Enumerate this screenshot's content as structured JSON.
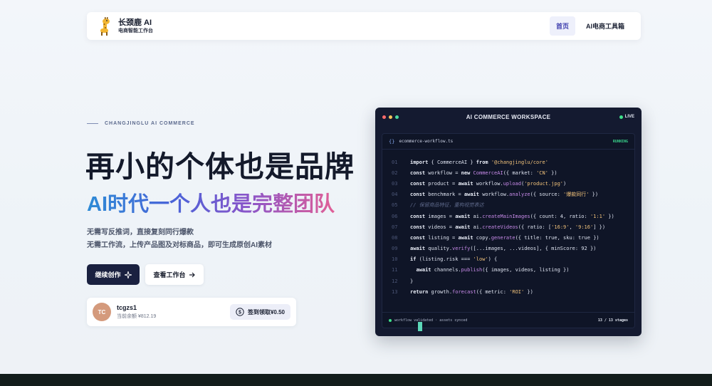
{
  "brand": {
    "name": "长颈鹿 AI",
    "subtitle": "电商智能工作台"
  },
  "nav": {
    "items": [
      {
        "label": "首页",
        "active": true
      },
      {
        "label": "AI电商工具箱",
        "active": false
      }
    ]
  },
  "hero": {
    "eyebrow": "CHANGJINGLU AI COMMERCE",
    "title": "再小的个体也是品牌",
    "subtitle": "AI时代一个人也是完整团队",
    "desc_line1": "无需写反推词，直接复刻同行爆款",
    "desc_line2": "无需工作流，上传产品图及对标商品，即可生成原创AI素材",
    "primary_button": "继续创作",
    "secondary_button": "查看工作台"
  },
  "user": {
    "initials": "TC",
    "name": "tcgzs1",
    "balance": "当前余额 ¥812.19",
    "checkin_label": "签到领取¥0.50"
  },
  "workspace": {
    "title": "AI COMMERCE WORKSPACE",
    "live_label": "LIVE",
    "file_name": "ecommerce-workflow.ts",
    "status": "RUNNING",
    "footer_text": "workflow validated · assets synced",
    "stages": "13 / 13 stages",
    "code_lines": [
      {
        "n": "01",
        "t": "import { CommerceAI } from '@changjinglu/core'"
      },
      {
        "n": "02",
        "t": "const workflow = new CommerceAI({ market: 'CN' })"
      },
      {
        "n": "03",
        "t": "const product = await workflow.upload('product.jpg')"
      },
      {
        "n": "04",
        "t": "const benchmark = await workflow.analyze({ source: '爆款同行' })"
      },
      {
        "n": "05",
        "t": "// 保留商品特征，重构视觉表达"
      },
      {
        "n": "06",
        "t": "const images = await ai.createMainImages({ count: 4, ratio: '1:1' })"
      },
      {
        "n": "07",
        "t": "const videos = await ai.createVideos({ ratio: ['16:9', '9:16'] })"
      },
      {
        "n": "08",
        "t": "const listing = await copy.generate({ title: true, sku: true })"
      },
      {
        "n": "09",
        "t": "await quality.verify([...images, ...videos], { minScore: 92 })"
      },
      {
        "n": "10",
        "t": "if (listing.risk === 'low') {"
      },
      {
        "n": "11",
        "t": "  await channels.publish({ images, videos, listing })"
      },
      {
        "n": "12",
        "t": "}"
      },
      {
        "n": "13",
        "t": "return growth.forecast({ metric: 'ROI' })"
      }
    ]
  },
  "colors": {
    "dark_navy": "#1a2140",
    "accent_green": "#3ee08a",
    "dot_red": "#ff6b6b",
    "dot_yellow": "#f7c35a",
    "dot_green": "#4ad7a0"
  },
  "icons": {
    "logo": "giraffe-icon",
    "sparkle": "sparkle-icon",
    "arrow": "arrow-right-icon",
    "coin": "coin-icon"
  }
}
